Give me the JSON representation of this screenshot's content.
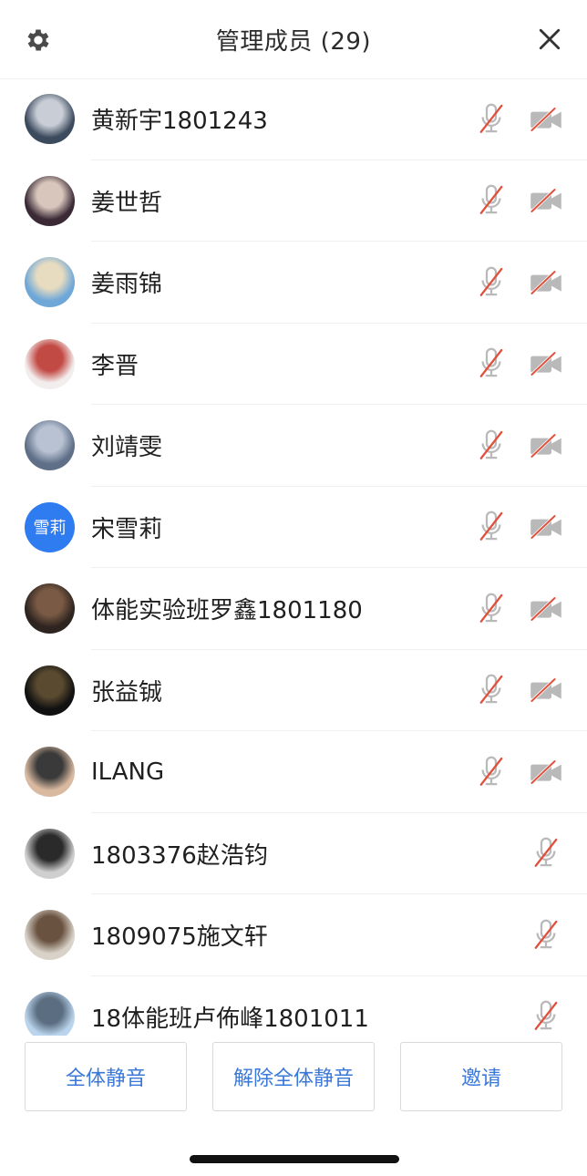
{
  "header": {
    "title": "管理成员 (29)"
  },
  "members": [
    {
      "name": "黄新宇1801243",
      "avatar": "photo",
      "avatar_colors": [
        "#3c4a5e",
        "#c9ced6"
      ],
      "mic": "mic-muted-icon",
      "camera": "camera-off-icon"
    },
    {
      "name": "姜世哲",
      "avatar": "photo",
      "avatar_colors": [
        "#3b2a36",
        "#d8c6bc"
      ],
      "mic": "mic-muted-icon",
      "camera": "camera-off-icon"
    },
    {
      "name": "姜雨锦",
      "avatar": "photo",
      "avatar_colors": [
        "#6fa8d8",
        "#e8dcc0"
      ],
      "mic": "mic-muted-icon",
      "camera": "camera-off-icon"
    },
    {
      "name": "李晋",
      "avatar": "photo",
      "avatar_colors": [
        "#f3eeee",
        "#c24a44"
      ],
      "mic": "mic-muted-icon",
      "camera": "camera-off-icon"
    },
    {
      "name": "刘靖雯",
      "avatar": "photo",
      "avatar_colors": [
        "#5f6f88",
        "#b8c2d2"
      ],
      "mic": "mic-muted-icon",
      "camera": "camera-off-icon"
    },
    {
      "name": "宋雪莉",
      "avatar": "text",
      "avatar_text": "雪莉",
      "avatar_colors": [
        "#2f7bf0",
        "#2f7bf0"
      ],
      "mic": "mic-muted-icon",
      "camera": "camera-off-icon"
    },
    {
      "name": "体能实验班罗鑫1801180",
      "avatar": "photo",
      "avatar_colors": [
        "#2e2420",
        "#7a5a44"
      ],
      "mic": "mic-muted-icon",
      "camera": "camera-off-icon"
    },
    {
      "name": "张益铖",
      "avatar": "photo",
      "avatar_colors": [
        "#111111",
        "#5a4a30"
      ],
      "mic": "mic-muted-icon",
      "camera": "camera-off-icon"
    },
    {
      "name": "ILANG",
      "avatar": "photo",
      "avatar_colors": [
        "#d9b9a0",
        "#3a3a3a"
      ],
      "mic": "mic-muted-icon",
      "camera": "camera-off-icon"
    },
    {
      "name": "1803376赵浩钧",
      "avatar": "photo",
      "avatar_colors": [
        "#cfcfcf",
        "#2a2a2a"
      ],
      "mic": "mic-muted-icon",
      "camera": ""
    },
    {
      "name": "1809075施文轩",
      "avatar": "photo",
      "avatar_colors": [
        "#d8d2c8",
        "#6a5240"
      ],
      "mic": "mic-muted-icon",
      "camera": ""
    },
    {
      "name": "18体能班卢佈峰1801011",
      "avatar": "photo",
      "avatar_colors": [
        "#b9d4ec",
        "#5b6d80"
      ],
      "mic": "mic-muted-icon",
      "camera": ""
    }
  ],
  "actions": {
    "mute_all": "全体静音",
    "unmute_all": "解除全体静音",
    "invite": "邀请"
  },
  "colors": {
    "accent": "#3a78d8",
    "muted_slash": "#e0503c",
    "icon_gray": "#b9b9b9"
  }
}
